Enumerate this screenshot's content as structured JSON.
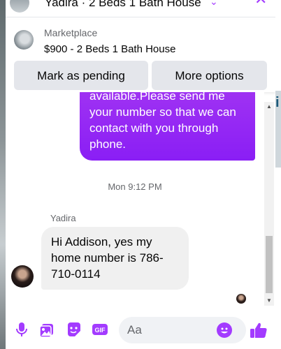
{
  "header": {
    "title": "Yadira · 2 Beds 1 Bath House",
    "chevron": "⌄",
    "close": "✕"
  },
  "marketplace": {
    "label": "Marketplace",
    "listing": "$900 - 2 Beds 1 Bath House",
    "mark_pending_label": "Mark as pending",
    "more_options_label": "More options"
  },
  "messages": {
    "outgoing_text": "available.Please send me your number so that we can contact with you through phone.",
    "timestamp": "Mon 9:12 PM",
    "incoming_sender": "Yadira",
    "incoming_text": "Hi Addison, yes my home number is 786-710-0114"
  },
  "composer": {
    "placeholder": "Aa",
    "icons": [
      "microphone-icon",
      "photo-icon",
      "sticker-icon",
      "gif-icon",
      "emoji-icon",
      "like-icon"
    ]
  },
  "colors": {
    "accent": "#a33bff",
    "bubble_out_top": "#a235f2",
    "bubble_in": "#f0f0f0",
    "like_blue": "#0084ff"
  },
  "scrollbar": {
    "position_fraction": 0.75
  }
}
